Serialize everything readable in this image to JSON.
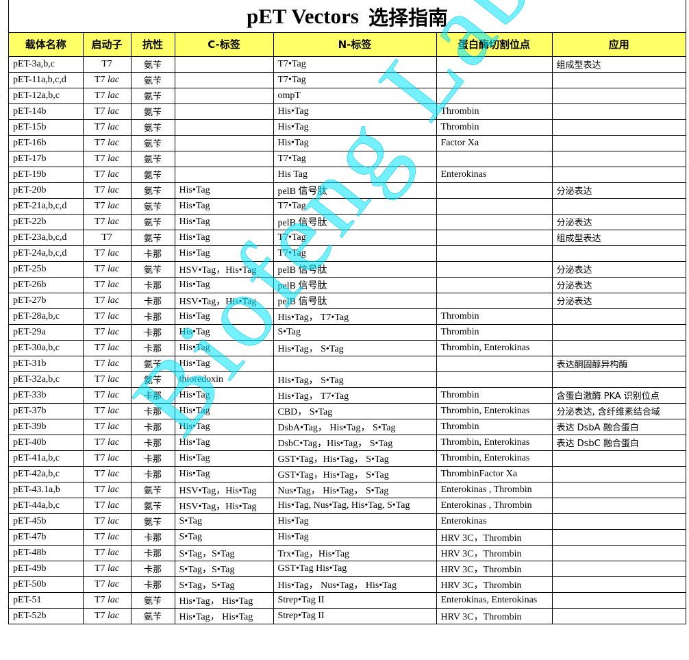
{
  "title": {
    "en": "pET Vectors",
    "zh": "选择指南"
  },
  "headers": [
    "载体名称",
    "启动子",
    "抗性",
    "C-标签",
    "N-标签",
    "蛋白酶切割位点",
    "应用"
  ],
  "rows": [
    {
      "name": "pET-3a,b,c",
      "promoter": "T7",
      "lac": false,
      "resistance": "氨苄",
      "ctag": "",
      "ntag": "T7•Tag",
      "protease": "",
      "application": "组成型表达"
    },
    {
      "name": "pET-11a,b,c,d",
      "promoter": "T7",
      "lac": true,
      "resistance": "氨苄",
      "ctag": "",
      "ntag": "T7•Tag",
      "protease": "",
      "application": ""
    },
    {
      "name": "pET-12a,b,c",
      "promoter": "T7",
      "lac": true,
      "resistance": "氨苄",
      "ctag": "",
      "ntag": "ompT",
      "protease": "",
      "application": ""
    },
    {
      "name": "pET-14b",
      "promoter": "T7",
      "lac": true,
      "resistance": "氨苄",
      "ctag": "",
      "ntag": "His•Tag",
      "protease": "Thrombin",
      "application": ""
    },
    {
      "name": "pET-15b",
      "promoter": "T7",
      "lac": true,
      "resistance": "氨苄",
      "ctag": "",
      "ntag": "His•Tag",
      "protease": "Thrombin",
      "application": ""
    },
    {
      "name": "pET-16b",
      "promoter": "T7",
      "lac": true,
      "resistance": "氨苄",
      "ctag": "",
      "ntag": "His•Tag",
      "protease": "Factor Xa",
      "application": ""
    },
    {
      "name": "pET-17b",
      "promoter": "T7",
      "lac": true,
      "resistance": "氨苄",
      "ctag": "",
      "ntag": "T7•Tag",
      "protease": "",
      "application": ""
    },
    {
      "name": "pET-19b",
      "promoter": "T7",
      "lac": true,
      "resistance": "氨苄",
      "ctag": "",
      "ntag": "His Tag",
      "protease": "Enterokinas",
      "application": ""
    },
    {
      "name": "pET-20b",
      "promoter": "T7",
      "lac": true,
      "resistance": "氨苄",
      "ctag": "His•Tag",
      "ntag": "pelB 信号肽",
      "protease": "",
      "application": "分泌表达"
    },
    {
      "name": "pET-21a,b,c,d",
      "promoter": "T7",
      "lac": true,
      "resistance": "氨苄",
      "ctag": "His•Tag",
      "ntag": "T7•Tag",
      "protease": "",
      "application": ""
    },
    {
      "name": "pET-22b",
      "promoter": "T7",
      "lac": true,
      "resistance": "氨苄",
      "ctag": "His•Tag",
      "ntag": "pelB 信号肽",
      "protease": "",
      "application": "分泌表达"
    },
    {
      "name": "pET-23a,b,c,d",
      "promoter": "T7",
      "lac": false,
      "resistance": "氨苄",
      "ctag": "His•Tag",
      "ntag": "T7•Tag",
      "protease": "",
      "application": "组成型表达"
    },
    {
      "name": "pET-24a,b,c,d",
      "promoter": "T7",
      "lac": true,
      "resistance": "卡那",
      "ctag": "His•Tag",
      "ntag": "T7•Tag",
      "protease": "",
      "application": ""
    },
    {
      "name": "pET-25b",
      "promoter": "T7",
      "lac": true,
      "resistance": "氨苄",
      "ctag": "HSV•Tag，His•Tag",
      "ntag": "pelB 信号肽",
      "protease": "",
      "application": "分泌表达"
    },
    {
      "name": "pET-26b",
      "promoter": "T7",
      "lac": true,
      "resistance": "卡那",
      "ctag": "His•Tag",
      "ntag": "pelB 信号肽",
      "protease": "",
      "application": "分泌表达"
    },
    {
      "name": "pET-27b",
      "promoter": "T7",
      "lac": true,
      "resistance": "卡那",
      "ctag": "HSV•Tag，His•Tag",
      "ntag": "pelB 信号肽",
      "protease": "",
      "application": "分泌表达"
    },
    {
      "name": "pET-28a,b,c",
      "promoter": "T7",
      "lac": true,
      "resistance": "卡那",
      "ctag": "His•Tag",
      "ntag": "His•Tag， T7•Tag",
      "protease": "Thrombin",
      "application": ""
    },
    {
      "name": "pET-29a",
      "promoter": "T7",
      "lac": true,
      "resistance": "卡那",
      "ctag": "His•Tag",
      "ntag": "S•Tag",
      "protease": "Thrombin",
      "application": ""
    },
    {
      "name": "pET-30a,b,c",
      "promoter": "T7",
      "lac": true,
      "resistance": "卡那",
      "ctag": "His•Tag",
      "ntag": "His•Tag， S•Tag",
      "protease": "Thrombin, Enterokinas",
      "application": ""
    },
    {
      "name": "pET-31b",
      "promoter": "T7",
      "lac": true,
      "resistance": "氨苄",
      "ctag": "His•Tag",
      "ntag": "",
      "protease": "",
      "application": "表达酮固醇异构酶"
    },
    {
      "name": "pET-32a,b,c",
      "promoter": "T7",
      "lac": true,
      "resistance": "氨苄",
      "ctag": "thioredoxin",
      "ntag": "His•Tag， S•Tag",
      "protease": "",
      "application": ""
    },
    {
      "name": "pET-33b",
      "promoter": "T7",
      "lac": true,
      "resistance": "卡那",
      "ctag": "His•Tag",
      "ntag": "His•Tag， T7•Tag",
      "protease": "Thrombin",
      "application": "含蛋白激酶 PKA 识别位点"
    },
    {
      "name": "pET-37b",
      "promoter": "T7",
      "lac": true,
      "resistance": "卡那",
      "ctag": "His•Tag",
      "ntag": "CBD， S•Tag",
      "protease": "Thrombin, Enterokinas",
      "application": "分泌表达, 含纤维素结合域"
    },
    {
      "name": "pET-39b",
      "promoter": "T7",
      "lac": true,
      "resistance": "卡那",
      "ctag": "His•Tag",
      "ntag": "DsbA•Tag， His•Tag， S•Tag",
      "protease": "Thrombin",
      "application": "表达 DsbA 融合蛋白"
    },
    {
      "name": "pET-40b",
      "promoter": "T7",
      "lac": true,
      "resistance": "卡那",
      "ctag": "His•Tag",
      "ntag": "DsbC•Tag，His•Tag， S•Tag",
      "protease": "Thrombin, Enterokinas",
      "application": "表达 DsbC 融合蛋白"
    },
    {
      "name": "pET-41a,b,c",
      "promoter": "T7",
      "lac": true,
      "resistance": "卡那",
      "ctag": "His•Tag",
      "ntag": "GST•Tag，His•Tag， S•Tag",
      "protease": "Thrombin, Enterokinas",
      "application": ""
    },
    {
      "name": "pET-42a,b,c",
      "promoter": "T7",
      "lac": true,
      "resistance": "卡那",
      "ctag": "His•Tag",
      "ntag": "GST•Tag，His•Tag， S•Tag",
      "protease": "ThrombinFactor Xa",
      "application": ""
    },
    {
      "name": "pET-43.1a,b",
      "promoter": "T7",
      "lac": true,
      "resistance": "氨苄",
      "ctag": "HSV•Tag，His•Tag",
      "ntag": "Nus•Tag， His•Tag， S•Tag",
      "protease": "Enterokinas , Thrombin",
      "application": ""
    },
    {
      "name": "pET-44a,b,c",
      "promoter": "T7",
      "lac": true,
      "resistance": "氨苄",
      "ctag": "HSV•Tag，His•Tag",
      "ntag": "His•Tag, Nus•Tag, His•Tag, S•Tag",
      "protease": "Enterokinas , Thrombin",
      "application": ""
    },
    {
      "name": "pET-45b",
      "promoter": "T7",
      "lac": true,
      "resistance": "氨苄",
      "ctag": "S•Tag",
      "ntag": "His•Tag",
      "protease": "Enterokinas",
      "application": ""
    },
    {
      "name": "pET-47b",
      "promoter": "T7",
      "lac": true,
      "resistance": "卡那",
      "ctag": "S•Tag",
      "ntag": "His•Tag",
      "protease": "HRV 3C，Thrombin",
      "application": ""
    },
    {
      "name": "pET-48b",
      "promoter": "T7",
      "lac": true,
      "resistance": "卡那",
      "ctag": "S•Tag，S•Tag",
      "ntag": "Trx•Tag，His•Tag",
      "protease": "HRV 3C，Thrombin",
      "application": ""
    },
    {
      "name": "pET-49b",
      "promoter": "T7",
      "lac": true,
      "resistance": "卡那",
      "ctag": "S•Tag，S•Tag",
      "ntag": "GST•Tag His•Tag",
      "protease": "HRV 3C，Thrombin",
      "application": ""
    },
    {
      "name": "pET-50b",
      "promoter": "T7",
      "lac": true,
      "resistance": "卡那",
      "ctag": "S•Tag，S•Tag",
      "ntag": "His•Tag， Nus•Tag， His•Tag",
      "protease": "HRV 3C，Thrombin",
      "application": ""
    },
    {
      "name": "pET-51",
      "promoter": "T7",
      "lac": true,
      "resistance": "氨苄",
      "ctag": "His•Tag， His•Tag",
      "ntag": "Strep•Tag II",
      "protease": "Enterokinas, Enterokinas",
      "application": ""
    },
    {
      "name": "pET-52b",
      "promoter": "T7",
      "lac": true,
      "resistance": "氨苄",
      "ctag": "His•Tag， His•Tag",
      "ntag": "Strep•Tag II",
      "protease": "HRV 3C，Thrombin",
      "application": ""
    }
  ],
  "lac_label": "lac",
  "watermark": "Biofeng Lab",
  "colors": {
    "header_bg": "#ffff66",
    "watermark": "#00e6ff"
  }
}
